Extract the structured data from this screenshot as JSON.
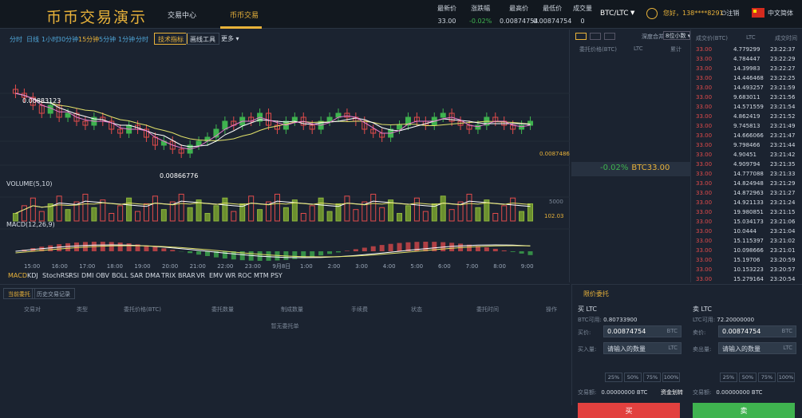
{
  "header": {
    "logo": "币币交易演示",
    "nav": [
      "交易中心",
      "币币交易"
    ],
    "stats": [
      {
        "label": "最新价",
        "value": "33.00"
      },
      {
        "label": "涨跌幅",
        "value": "-0.02%"
      },
      {
        "label": "最高价",
        "value": "0.00874754"
      },
      {
        "label": "最低价",
        "value": "0.00874754"
      },
      {
        "label": "成交量",
        "value": "0"
      }
    ],
    "pair": "BTC/LTC",
    "user": "您好，138****8291",
    "logout": "注销",
    "lang": "中文简体",
    "colors": {
      "accent": "#e8b23a",
      "up": "#3fb34f",
      "down": "#e24b4b"
    }
  },
  "periods": [
    "分时",
    "日线",
    "1小时",
    "30分钟",
    "15分钟",
    "5分钟",
    "1分钟",
    "分时"
  ],
  "tools": {
    "tech": "技术指标",
    "draw": "画线工具",
    "more": "更多"
  },
  "chart_data": {
    "type": "candlestick",
    "title": "",
    "labels": {
      "high": "0.00883123",
      "low": "0.00866776",
      "last": "0.0087486",
      "volume": "VOLUME(5,10)",
      "volume_last": "102.03",
      "volume_tick": "5000",
      "macd": "MACD(12,26,9)"
    },
    "x_ticks": [
      "15:00",
      "16:00",
      "17:00",
      "18:00",
      "19:00",
      "20:00",
      "21:00",
      "22:00",
      "23:00",
      "9月8日",
      "1:00",
      "2:00",
      "3:00",
      "4:00",
      "5:00",
      "6:00",
      "7:00",
      "8:00",
      "9:00"
    ],
    "ohlc_closes": [
      0.00882,
      0.00881,
      0.00879,
      0.00877,
      0.00879,
      0.00876,
      0.00877,
      0.00875,
      0.00874,
      0.00876,
      0.00875,
      0.00873,
      0.00872,
      0.00874,
      0.00873,
      0.00871,
      0.00869,
      0.0087,
      0.00868,
      0.00867,
      0.00869,
      0.0087,
      0.00871,
      0.00873,
      0.00875,
      0.00874,
      0.00876,
      0.00875,
      0.00877,
      0.00874,
      0.00873,
      0.00875,
      0.00876,
      0.00874,
      0.00873,
      0.00875,
      0.00876,
      0.00877,
      0.00876,
      0.00875,
      0.00873,
      0.00872,
      0.00871,
      0.00873,
      0.00874,
      0.00876,
      0.00875,
      0.00874,
      0.00876,
      0.00877,
      0.00875,
      0.00874,
      0.00873,
      0.00874,
      0.00876,
      0.00875,
      0.00874,
      0.00873,
      0.00874,
      0.00875
    ]
  },
  "indicators": [
    "MACD",
    "KDJ",
    "StochRSI",
    "RSI",
    "DMI",
    "OBV",
    "BOLL",
    "SAR",
    "DMA",
    "TRIX",
    "BRAR",
    "VR",
    "EMV",
    "WR",
    "ROC",
    "MTM",
    "PSY"
  ],
  "book": {
    "depth_label": "深度合并",
    "depth_value": "8位小数",
    "headers": [
      "委托价格(BTC)",
      "LTC",
      "累计"
    ],
    "change": "-0.02%",
    "price": "BTC33.00"
  },
  "trades": {
    "headers": [
      "成交价(BTC)",
      "LTC",
      "成交时间"
    ],
    "rows": [
      [
        "33.00",
        "4.779299",
        "23:22:37"
      ],
      [
        "33.00",
        "4.784447",
        "23:22:29"
      ],
      [
        "33.00",
        "14.39983",
        "23:22:27"
      ],
      [
        "33.00",
        "14.446468",
        "23:22:25"
      ],
      [
        "33.00",
        "14.493257",
        "23:21:59"
      ],
      [
        "33.00",
        "9.683011",
        "23:21:56"
      ],
      [
        "33.00",
        "14.571559",
        "23:21:54"
      ],
      [
        "33.00",
        "4.862419",
        "23:21:52"
      ],
      [
        "33.00",
        "9.745813",
        "23:21:49"
      ],
      [
        "33.00",
        "14.666066",
        "23:21:47"
      ],
      [
        "33.00",
        "9.798466",
        "23:21:44"
      ],
      [
        "33.00",
        "4.90451",
        "23:21:42"
      ],
      [
        "33.00",
        "4.909794",
        "23:21:35"
      ],
      [
        "33.00",
        "14.777088",
        "23:21:33"
      ],
      [
        "33.00",
        "14.824948",
        "23:21:29"
      ],
      [
        "33.00",
        "14.872963",
        "23:21:27"
      ],
      [
        "33.00",
        "14.921133",
        "23:21:24"
      ],
      [
        "33.00",
        "19.980851",
        "23:21:15"
      ],
      [
        "33.00",
        "15.034173",
        "23:21:06"
      ],
      [
        "33.00",
        "10.0444",
        "23:21:04"
      ],
      [
        "33.00",
        "15.115397",
        "23:21:02"
      ],
      [
        "33.00",
        "10.098666",
        "23:21:01"
      ],
      [
        "33.00",
        "15.19706",
        "23:20:59"
      ],
      [
        "33.00",
        "10.153223",
        "23:20:57"
      ],
      [
        "33.00",
        "15.279164",
        "23:20:54"
      ]
    ]
  },
  "orders": {
    "tabs": [
      "当前委托",
      "历史交易记录"
    ],
    "headers": [
      "交易对",
      "类型",
      "委托价格(BTC)",
      "委托数量",
      "制成数量",
      "手续费",
      "状态",
      "委托时间",
      "操作"
    ],
    "empty": "暂无委托单"
  },
  "form": {
    "tab": "限价委托",
    "buy": {
      "title": "买 LTC",
      "avail_label": "BTC可用:",
      "avail": "0.80733900",
      "price_label": "买价:",
      "price": "0.00874754",
      "price_unit": "BTC",
      "qty_label": "买入量:",
      "qty_placeholder": "请输入的数量",
      "qty_unit": "LTC",
      "total_label": "交易额:",
      "total": "0.00000000 BTC",
      "transfer": "资金划转",
      "submit": "买"
    },
    "sell": {
      "title": "卖 LTC",
      "avail_label": "LTC可用:",
      "avail": "72.20000000",
      "price_label": "卖价:",
      "price": "0.00874754",
      "price_unit": "BTC",
      "qty_label": "卖出量:",
      "qty_placeholder": "请输入的数量",
      "qty_unit": "LTC",
      "total_label": "交易额:",
      "total": "0.00000000 BTC",
      "submit": "卖"
    },
    "percents": [
      "25%",
      "50%",
      "75%",
      "100%"
    ]
  }
}
